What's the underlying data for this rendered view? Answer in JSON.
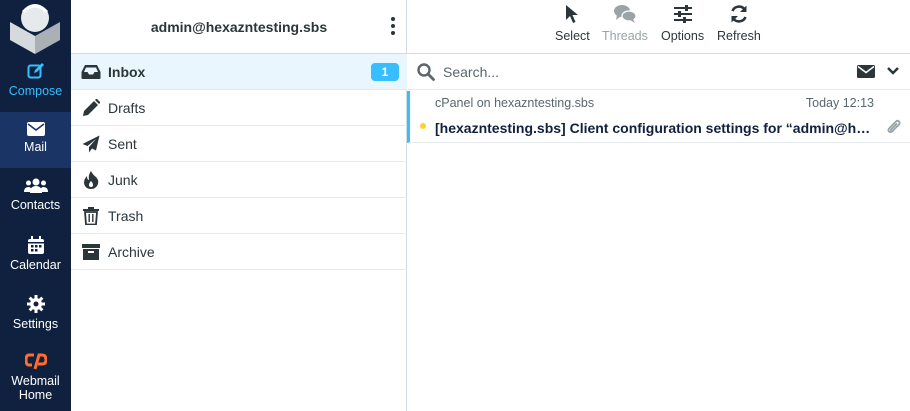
{
  "nav": {
    "items": [
      {
        "label": "Compose",
        "icon": "compose-icon"
      },
      {
        "label": "Mail",
        "icon": "envelope-icon"
      },
      {
        "label": "Contacts",
        "icon": "users-icon"
      },
      {
        "label": "Calendar",
        "icon": "calendar-icon"
      },
      {
        "label": "Settings",
        "icon": "gear-icon"
      },
      {
        "label": "Webmail",
        "label2": "Home",
        "icon": "cpanel-icon"
      }
    ]
  },
  "folders": {
    "account": "admin@hexazntesting.sbs",
    "items": [
      {
        "label": "Inbox",
        "icon": "inbox-icon",
        "count": "1"
      },
      {
        "label": "Drafts",
        "icon": "pencil-icon"
      },
      {
        "label": "Sent",
        "icon": "paper-plane-icon"
      },
      {
        "label": "Junk",
        "icon": "fire-icon"
      },
      {
        "label": "Trash",
        "icon": "trash-icon"
      },
      {
        "label": "Archive",
        "icon": "archive-icon"
      }
    ]
  },
  "toolbar": {
    "select": "Select",
    "threads": "Threads",
    "options": "Options",
    "refresh": "Refresh"
  },
  "search": {
    "placeholder": "Search..."
  },
  "messages": [
    {
      "from": "cPanel on hexazntesting.sbs",
      "date": "Today 12:13",
      "subject": "[hexazntesting.sbs] Client configuration settings for “admin@hexazntesting.sbs”.",
      "unread": true,
      "attachment": true
    }
  ],
  "colors": {
    "nav_bg": "#10213f",
    "nav_active": "#1b3466",
    "accent": "#37beff",
    "cpanel_orange": "#ff6c2c",
    "unread_dot": "#ffd129"
  }
}
